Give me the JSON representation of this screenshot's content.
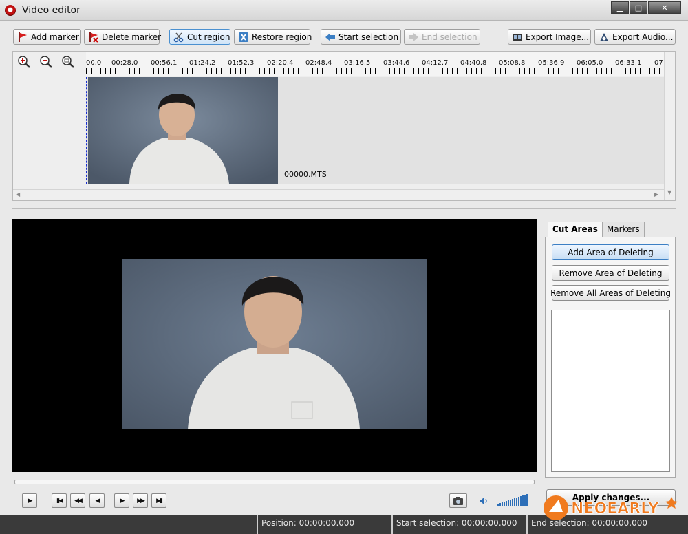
{
  "window": {
    "title": "Video editor",
    "minimize": "▁",
    "maximize": "□",
    "close": "✕"
  },
  "toolbar": {
    "add_marker": "Add marker",
    "delete_marker": "Delete marker",
    "cut_region": "Cut region",
    "restore_region": "Restore region",
    "start_selection": "Start selection",
    "end_selection": "End selection",
    "export_image": "Export Image...",
    "export_audio": "Export Audio..."
  },
  "timeline": {
    "ticks": [
      "00.0",
      "00:28.0",
      "00:56.1",
      "01:24.2",
      "01:52.3",
      "02:20.4",
      "02:48.4",
      "03:16.5",
      "03:44.6",
      "04:12.7",
      "04:40.8",
      "05:08.8",
      "05:36.9",
      "06:05.0",
      "06:33.1",
      "07"
    ],
    "clip_name": "00000.MTS"
  },
  "tabs": {
    "cut_areas": "Cut Areas",
    "markers": "Markers"
  },
  "cut_panel": {
    "add": "Add Area of Deleting",
    "remove": "Remove Area of Deleting",
    "remove_all": "Remove All Areas of Deleting"
  },
  "apply_label": "Apply changes...",
  "status": {
    "position": "Position: 00:00:00.000",
    "start": "Start selection: 00:00:00.000",
    "end": "End selection: 00:00:00.000"
  },
  "watermark_text": "NEOEARLY",
  "colors": {
    "selection_line": "#1a2fd0",
    "accent": "#3c7fc4",
    "status_bg": "#3a3a3a",
    "watermark": "#f07a1e"
  }
}
